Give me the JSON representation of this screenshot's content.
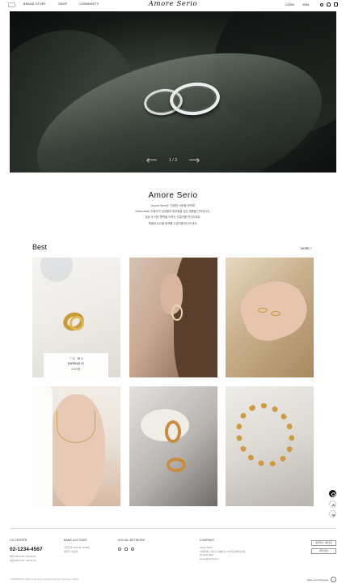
{
  "header": {
    "nav": [
      "BRAND STORY",
      "SHOP",
      "COMMUNITY"
    ],
    "brand": "Amore Serio",
    "login": "LOGIN",
    "join": "JOIN"
  },
  "hero": {
    "pager": "1 / 3"
  },
  "intro": {
    "title": "Amore Serio",
    "lines": [
      "Amore Serio는 '진정한 사랑'을 뜻하며",
      "Hand-made 주얼리의 섬세함과 정교함을 담은 제품을 선보입니다.",
      "일상 속 작은 행복을 더하는 주얼리를 만나보세요.",
      "특별한 순간을 함께할 주얼리를 만나보세요."
    ]
  },
  "best": {
    "title": "Best",
    "more": "MORE +",
    "overlay": {
      "like_count": "0",
      "review_count": "0",
      "name": "EARRING 01",
      "price": "8,000원"
    }
  },
  "footer": {
    "cs_head": "CS CENTER",
    "phone": "02-1234-4567",
    "cs_hours": [
      "평일 AM 10:00 - PM 05:00",
      "점심 PM 12:00 - PM 01:00"
    ],
    "bank_head": "BANK ACCOUNT",
    "bank_lines": [
      "국민은행 1234-56-123456",
      "예금주: 아모레"
    ],
    "social_head": "SOCIAL NETWORK",
    "company_head": "COMPANY",
    "company_lines": [
      "Amore Serio",
      "서울특별시 강남구 테헤란로 123 아모레빌딩 3층",
      "02-1234-4567",
      "amore@gmail.com"
    ],
    "btn1": "이용약관 / 개인정보",
    "btn2": "사업자정보",
    "copyright": "COPYRIGHT(C) 2024 Amore Serio. All rights reserved. Hosting by cafe24",
    "lang": "Select your language"
  }
}
